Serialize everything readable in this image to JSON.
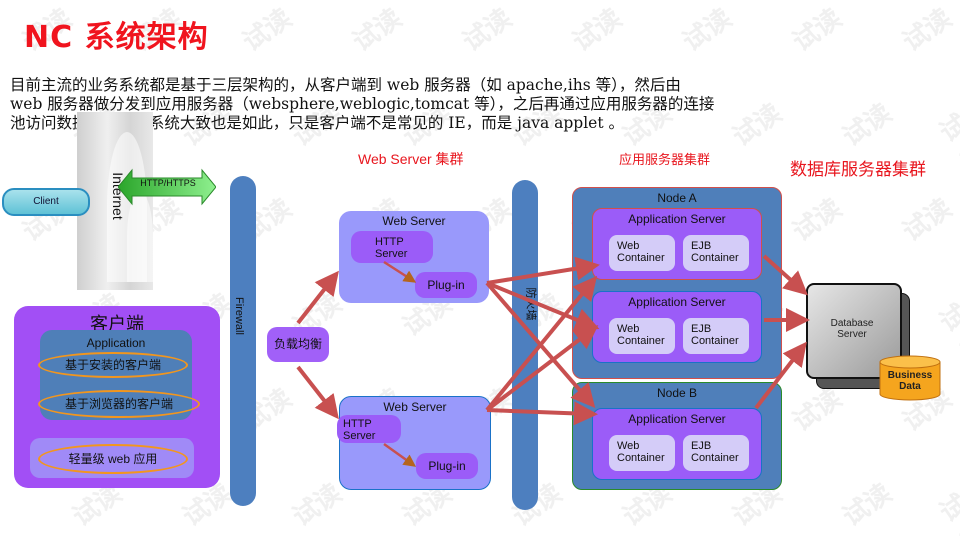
{
  "title": "NC 系统架构",
  "intro": [
    "目前主流的业务系统都是基于三层架构的，从客户端到 web 服务器（如 apache,ihs 等），然后由",
    "web 服务器做分发到应用服务器（websphere,weblogic,tomcat 等），之后再通过应用服务器的连接",
    "池访问数据库。NC 系统大致也是如此，只是客户端不是常见的 IE，而是 java applet 。"
  ],
  "sections": {
    "web_cluster": "Web Server 集群",
    "app_cluster": "应用服务器集群",
    "db_cluster": "数据库服务器集群"
  },
  "internet": {
    "label": "Internet",
    "client": "Client",
    "protocol": "HTTP/HTTPS"
  },
  "client_panel": {
    "title": "客户端",
    "application": "Application",
    "installed": "基于安装的客户端",
    "browser": "基于浏览器的客户端",
    "lightweight": "轻量级 web 应用"
  },
  "firewall1": "Firewall",
  "firewall2": "防火墙",
  "load_balancer": "负载均衡",
  "web_servers": [
    {
      "title": "Web Server",
      "http": "HTTP Server",
      "plugin": "Plug-in"
    },
    {
      "title": "Web Server",
      "http": "HTTP Server",
      "plugin": "Plug-in"
    }
  ],
  "nodes": [
    {
      "title": "Node A",
      "app_servers": [
        {
          "title": "Application Server",
          "web": "Web Container",
          "ejb": "EJB Container"
        },
        {
          "title": "Application Server",
          "web": "Web Container",
          "ejb": "EJB Container"
        }
      ]
    },
    {
      "title": "Node B",
      "app_servers": [
        {
          "title": "Application Server",
          "web": "Web Container",
          "ejb": "EJB Container"
        }
      ]
    }
  ],
  "database": {
    "server": "Database Server",
    "data": "Business Data"
  },
  "watermark": "试读",
  "colors": {
    "title_red": "#f0141e",
    "purple": "#9b5cf8",
    "blue_firewall": "#4d7fbf",
    "arrow_red": "#c85050",
    "orange": "#f2961e"
  }
}
